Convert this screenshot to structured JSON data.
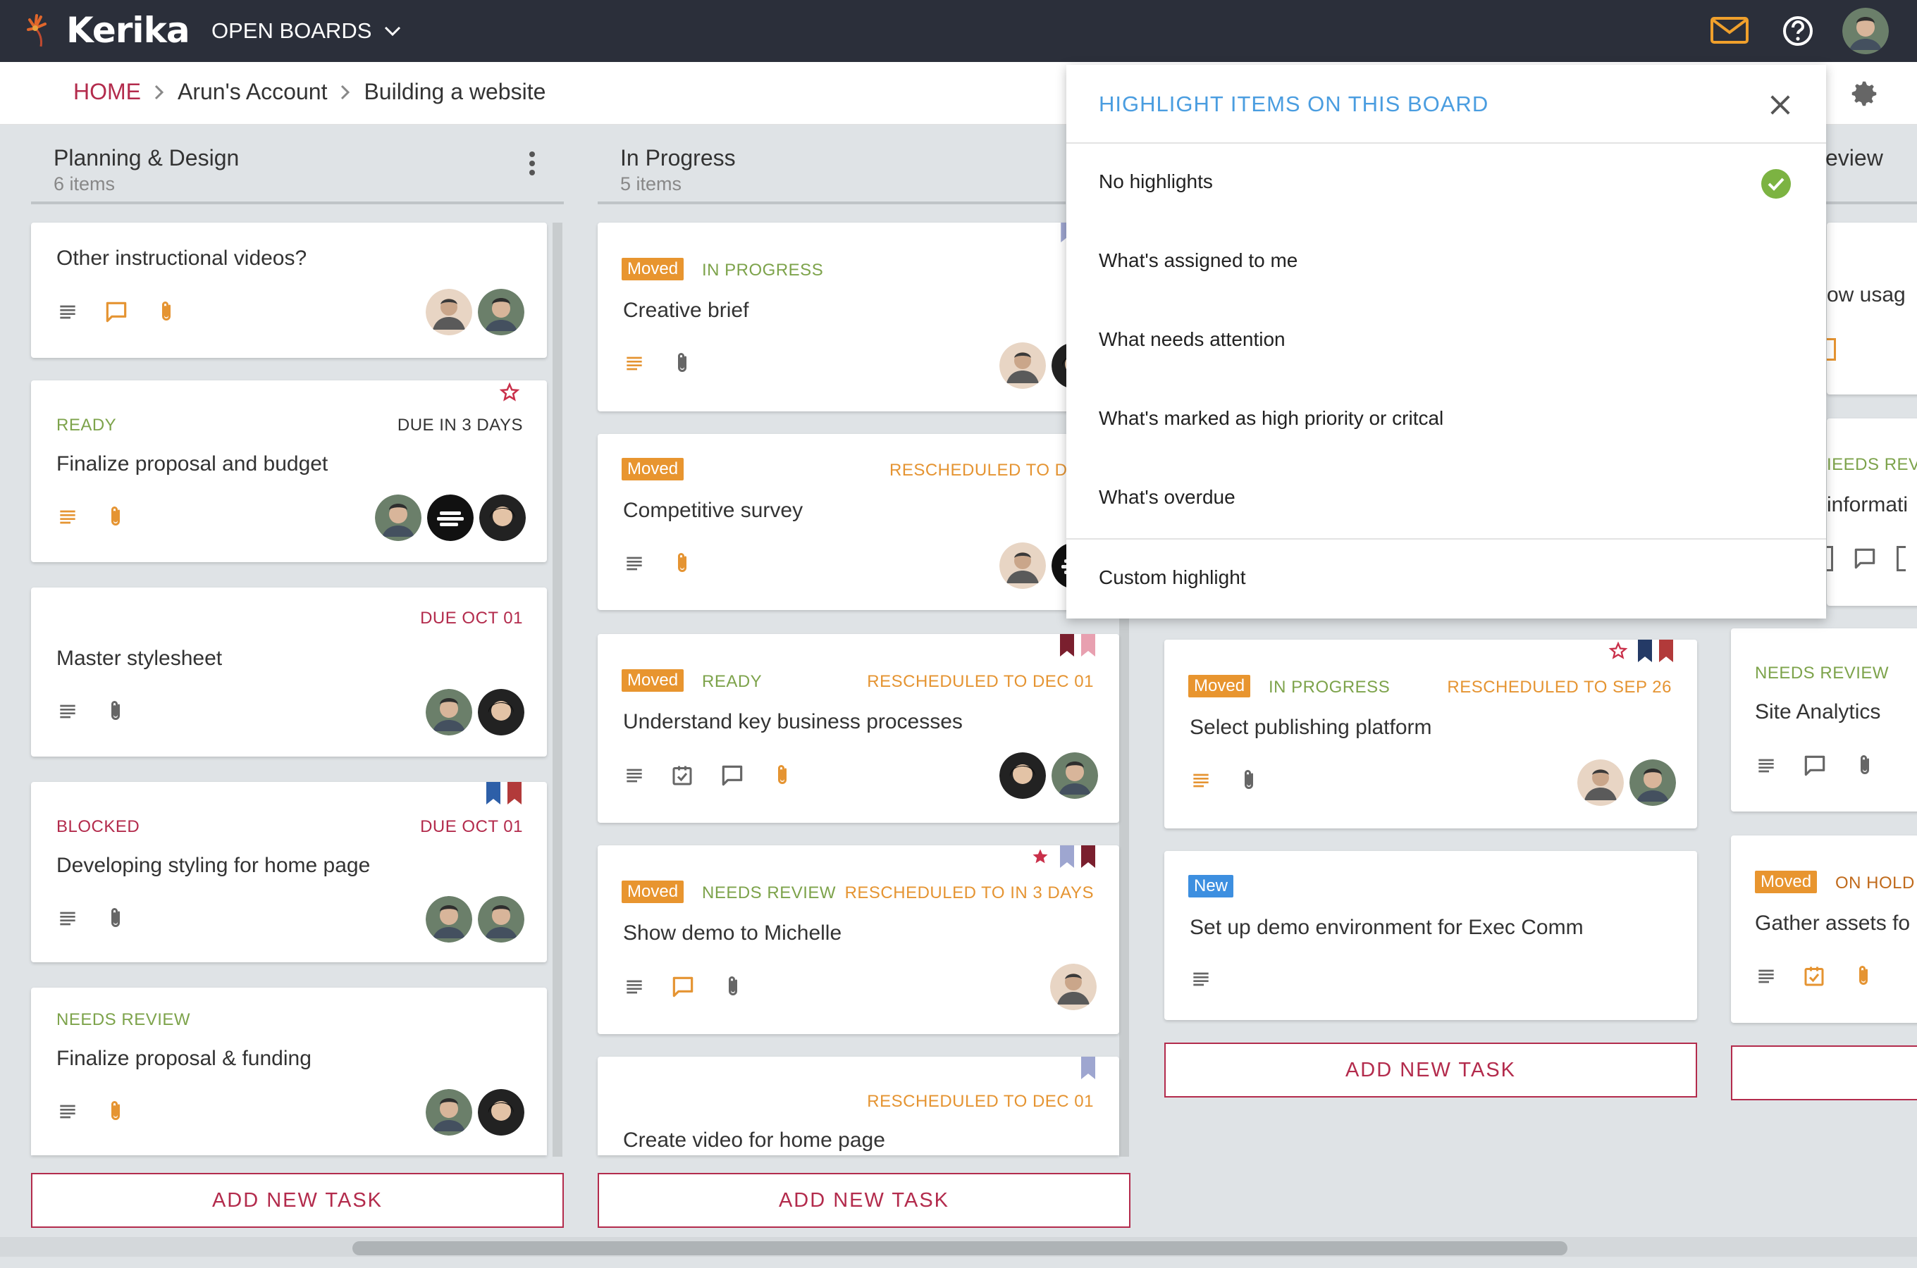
{
  "app": {
    "name": "Kerika",
    "menu_label": "OPEN BOARDS"
  },
  "breadcrumb": {
    "home": "HOME",
    "account": "Arun's Account",
    "board": "Building a website"
  },
  "columns": [
    {
      "title": "Planning & Design",
      "count": "6 items",
      "cards": [
        {
          "title": "Other instructional videos?"
        },
        {
          "status": "READY",
          "due": "DUE IN 3 DAYS",
          "title": "Finalize proposal and budget"
        },
        {
          "due": "DUE OCT 01",
          "title": "Master stylesheet"
        },
        {
          "status": "BLOCKED",
          "due": "DUE OCT 01",
          "title": "Developing styling for home page"
        },
        {
          "status": "NEEDS REVIEW",
          "title": "Finalize proposal & funding"
        }
      ],
      "add_label": "ADD NEW TASK"
    },
    {
      "title": "In Progress",
      "count": "5 items",
      "cards": [
        {
          "badge": "Moved",
          "status": "IN PROGRESS",
          "title": "Creative brief"
        },
        {
          "badge": "Moved",
          "resched": "RESCHEDULED TO DEC",
          "title": "Competitive survey"
        },
        {
          "badge": "Moved",
          "status": "READY",
          "resched": "RESCHEDULED TO DEC 01",
          "title": "Understand key business processes"
        },
        {
          "badge": "Moved",
          "status": "NEEDS REVIEW",
          "resched": "RESCHEDULED TO IN 3 DAYS",
          "title": "Show demo to Michelle"
        },
        {
          "resched": "RESCHEDULED TO DEC 01",
          "title": "Create video for home page"
        }
      ],
      "add_label": "ADD NEW TASK"
    },
    {
      "cards": [
        {
          "badge": "Moved",
          "status": "IN PROGRESS",
          "resched": "RESCHEDULED TO SEP 26",
          "title": "Select publishing platform"
        },
        {
          "badge": "New",
          "title": "Set up demo environment for Exec Comm"
        }
      ],
      "add_label": "ADD NEW TASK"
    },
    {
      "title_partial": "eview",
      "cards": [
        {
          "title": "ow usag"
        },
        {
          "status": "IEEDS REVI",
          "title": "informati"
        },
        {
          "status": "NEEDS REVIEW",
          "title": "Site Analytics"
        },
        {
          "badge": "Moved",
          "status": "ON HOLD",
          "title": "Gather assets fo"
        }
      ]
    }
  ],
  "highlight_panel": {
    "title": "HIGHLIGHT ITEMS ON THIS BOARD",
    "options": [
      "No highlights",
      "What's assigned to me",
      "What needs attention",
      "What's marked as high priority or critcal",
      "What's overdue"
    ],
    "custom": "Custom highlight",
    "selected_index": 0
  },
  "colors": {
    "accent": "#b32b4c",
    "topbar": "#2b2f3a",
    "moved": "#e8952f",
    "new": "#3d8fe0",
    "status_green": "#7da34b",
    "resched": "#e59432",
    "panel_title": "#4a9de0"
  }
}
